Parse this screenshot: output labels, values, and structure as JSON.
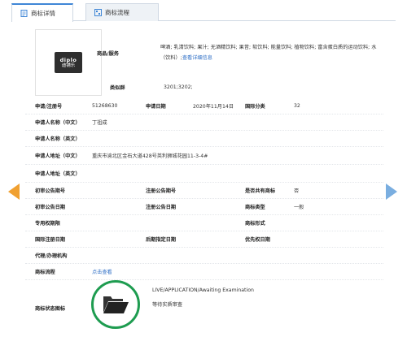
{
  "tabs": [
    {
      "label": "商标详情"
    },
    {
      "label": "商标流程"
    }
  ],
  "logo": {
    "line1": "diplo",
    "line2": "迪铺乐"
  },
  "goods": {
    "label": "商品/服务",
    "value": "啤酒; 乳清饮料; 果汁; 无酒精饮料; 果昔; 软饮料; 能量饮料; 植物饮料; 富含蛋白质的运动饮料; 水（饮料）;",
    "link": "查看详细信息"
  },
  "similar_group": {
    "label": "类似群",
    "value": "3201;3202;"
  },
  "fields": {
    "reg_no_label": "申请/注册号",
    "reg_no": "51268630",
    "apply_date_label": "申请日期",
    "apply_date": "2020年11月14日",
    "intl_class_label": "国际分类",
    "intl_class": "32",
    "applicant_cn_label": "申请人名称（中文）",
    "applicant_cn": "丁祖成",
    "applicant_en_label": "申请人名称（英文）",
    "address_cn_label": "申请人地址（中文）",
    "address_cn": "重庆市渝北区金石大道428号英利狮城花园11-3-4#",
    "address_en_label": "申请人地址（英文）",
    "prelim_issue_label": "初审公告期号",
    "reg_issue_label": "注册公告期号",
    "shared_label": "是否共有商标",
    "shared": "否",
    "prelim_date_label": "初审公告日期",
    "reg_date_label": "注册公告日期",
    "tm_type_label": "商标类型",
    "tm_type": "一般",
    "exclusive_label": "专用权期限",
    "tm_form_label": "商标形式",
    "intl_reg_date_label": "国际注册日期",
    "later_date_label": "后期指定日期",
    "priority_date_label": "优先权日期",
    "agent_label": "代理/办理机构",
    "process_label": "商标流程",
    "process_link": "点击查看",
    "status_icon_label": "商标状态图标",
    "status_en": "LIVE/APPLICATION/Awaiting Examination",
    "status_cn": "等待实质审查"
  },
  "colors": {
    "accent": "#3f86d6",
    "link": "#2f6fc6",
    "prev_arrow": "#f0a030",
    "next_arrow": "#7aaee0",
    "status_ring": "#1e9c50"
  },
  "icons": [
    "document-icon",
    "flow-icon",
    "prev-arrow-icon",
    "next-arrow-icon",
    "folder-open-icon"
  ]
}
